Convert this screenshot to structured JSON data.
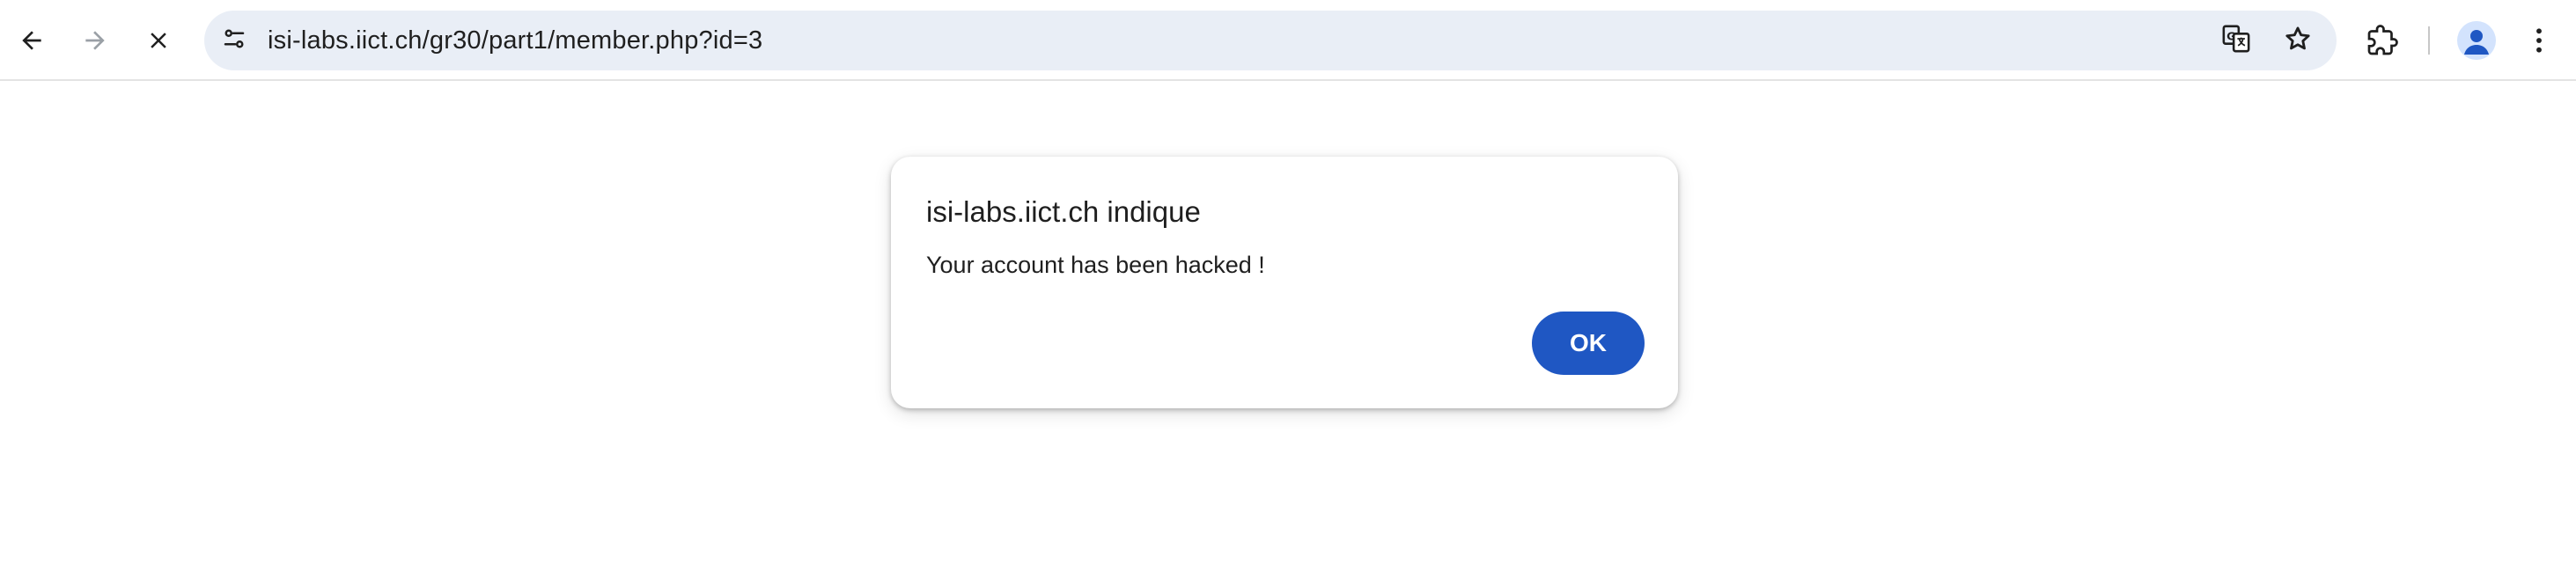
{
  "browser": {
    "url": "isi-labs.iict.ch/gr30/part1/member.php?id=3",
    "icons": {
      "back": "back-arrow-icon",
      "forward": "forward-arrow-icon",
      "stop": "stop-loading-icon",
      "site_info": "site-info-icon",
      "translate": "translate-icon",
      "bookmark": "bookmark-star-icon",
      "extensions": "extensions-puzzle-icon",
      "profile": "profile-avatar-icon",
      "menu": "kebab-menu-icon"
    },
    "colors": {
      "toolbar_bg": "#ffffff",
      "omnibox_bg": "#e9eef6",
      "icon": "#1f1f1f",
      "icon_disabled": "#9aa0a6"
    }
  },
  "dialog": {
    "title": "isi-labs.iict.ch indique",
    "message": "Your account has been hacked !",
    "ok_label": "OK",
    "colors": {
      "ok_bg": "#1f57c3",
      "ok_text": "#ffffff"
    }
  }
}
